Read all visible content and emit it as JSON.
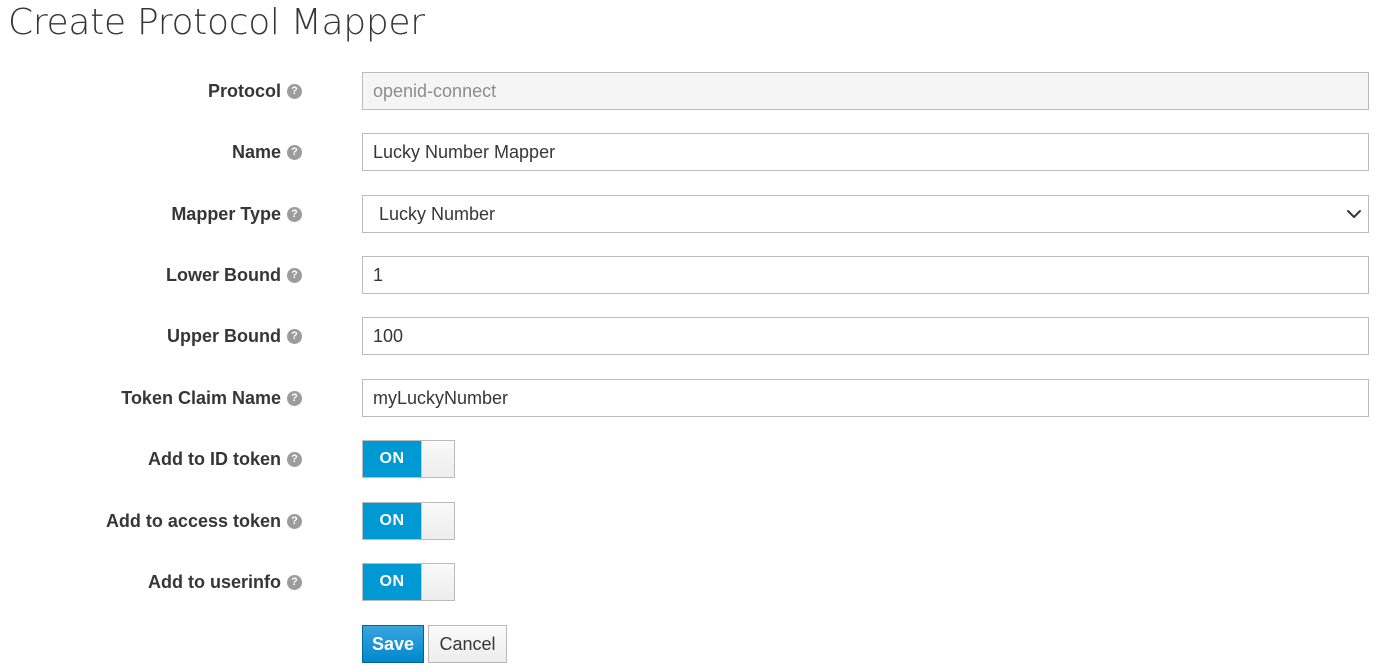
{
  "page": {
    "title": "Create Protocol Mapper"
  },
  "form": {
    "protocol": {
      "label": "Protocol",
      "value": "openid-connect"
    },
    "name": {
      "label": "Name",
      "value": "Lucky Number Mapper"
    },
    "mapper_type": {
      "label": "Mapper Type",
      "selected": "Lucky Number"
    },
    "lower_bound": {
      "label": "Lower Bound",
      "value": "1"
    },
    "upper_bound": {
      "label": "Upper Bound",
      "value": "100"
    },
    "token_claim_name": {
      "label": "Token Claim Name",
      "value": "myLuckyNumber"
    },
    "add_to_id_token": {
      "label": "Add to ID token",
      "state": "ON"
    },
    "add_to_access_token": {
      "label": "Add to access token",
      "state": "ON"
    },
    "add_to_userinfo": {
      "label": "Add to userinfo",
      "state": "ON"
    }
  },
  "help_icon_glyph": "?",
  "buttons": {
    "save_label": "Save",
    "cancel_label": "Cancel"
  },
  "colors": {
    "toggle_on": "#0099d3",
    "primary_button": "#0088ce",
    "help_icon": "#9c9c9c"
  },
  "icons": {
    "help": "question-circle-icon",
    "select": "chevron-down-icon"
  }
}
